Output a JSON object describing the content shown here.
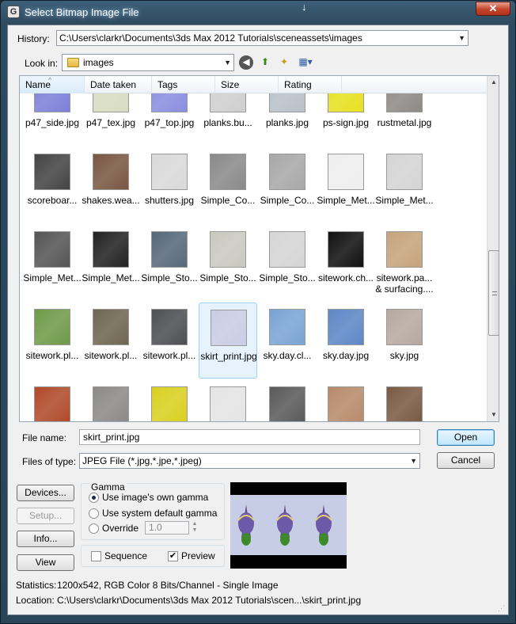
{
  "window": {
    "title": "Select Bitmap Image File",
    "close_glyph": "✕",
    "app_icon": "G"
  },
  "history": {
    "label": "History:",
    "value": "C:\\Users\\clarkr\\Documents\\3ds Max 2012 Tutorials\\sceneassets\\images"
  },
  "look_in": {
    "label": "Look in:",
    "value": "images"
  },
  "toolbar_icons": [
    "back-icon",
    "up-folder-icon",
    "new-folder-icon",
    "view-menu-icon"
  ],
  "columns": [
    "Name",
    "Date taken",
    "Tags",
    "Size",
    "Rating"
  ],
  "files": [
    {
      "name": "p47_side.jpg",
      "tint": "#7d80d8"
    },
    {
      "name": "p47_tex.jpg",
      "tint": "#d8dcc0"
    },
    {
      "name": "p47_top.jpg",
      "tint": "#8a8ee0"
    },
    {
      "name": "planks.bu...",
      "tint": "#cfcfcf"
    },
    {
      "name": "planks.jpg",
      "tint": "#b9c0c8"
    },
    {
      "name": "ps-sign.jpg",
      "tint": "#e8e020"
    },
    {
      "name": "rustmetal.jpg",
      "tint": "#8d8a86"
    },
    {
      "name": "scoreboar...",
      "tint": "#444444"
    },
    {
      "name": "shakes.wea...",
      "tint": "#7a5642"
    },
    {
      "name": "shutters.jpg",
      "tint": "#d9d9d9"
    },
    {
      "name": "Simple_Co...",
      "tint": "#8a8a8a"
    },
    {
      "name": "Simple_Co...",
      "tint": "#a8a8a8"
    },
    {
      "name": "Simple_Met...",
      "tint": "#eeeeee"
    },
    {
      "name": "Simple_Met...",
      "tint": "#d4d4d4"
    },
    {
      "name": "Simple_Met...",
      "tint": "#555555"
    },
    {
      "name": "Simple_Met...",
      "tint": "#222222"
    },
    {
      "name": "Simple_Sto...",
      "tint": "#56687a"
    },
    {
      "name": "Simple_Sto...",
      "tint": "#c9c9c0"
    },
    {
      "name": "Simple_Sto...",
      "tint": "#d5d5d5"
    },
    {
      "name": "sitework.ch...",
      "tint": "#111111"
    },
    {
      "name": "sitework.pa... & surfacing....",
      "tint": "#c6a47c"
    },
    {
      "name": "sitework.pl...",
      "tint": "#6f9a48"
    },
    {
      "name": "sitework.pl...",
      "tint": "#6e6650"
    },
    {
      "name": "sitework.pl...",
      "tint": "#4d4f52"
    },
    {
      "name": "skirt_print.jpg",
      "tint": "#c9cde4"
    },
    {
      "name": "sky.day.cl...",
      "tint": "#7aa4d4"
    },
    {
      "name": "sky.day.jpg",
      "tint": "#5d87c6"
    },
    {
      "name": "sky.jpg",
      "tint": "#b7a9a0"
    },
    {
      "name": "",
      "tint": "#b04a2a"
    },
    {
      "name": "",
      "tint": "#8c8a88"
    },
    {
      "name": "",
      "tint": "#d9d020"
    },
    {
      "name": "",
      "tint": "#e4e4e4"
    },
    {
      "name": "",
      "tint": "#5a5a5a"
    },
    {
      "name": "",
      "tint": "#b88a6a"
    },
    {
      "name": "",
      "tint": "#7a5a44"
    }
  ],
  "selected_file": "skirt_print.jpg",
  "file_name": {
    "label": "File name:",
    "value": "skirt_print.jpg"
  },
  "files_of_type": {
    "label": "Files of type:",
    "value": "JPEG File (*.jpg,*.jpe,*.jpeg)"
  },
  "buttons": {
    "open": "Open",
    "cancel": "Cancel",
    "devices": "Devices...",
    "setup": "Setup...",
    "info": "Info...",
    "view": "View"
  },
  "gamma": {
    "title": "Gamma",
    "own": "Use image's own gamma",
    "system": "Use system default gamma",
    "override": "Override",
    "override_value": "1.0",
    "selected": "own"
  },
  "options": {
    "sequence": "Sequence",
    "preview": "Preview",
    "sequence_checked": false,
    "preview_checked": true
  },
  "statistics": {
    "label": "Statistics:",
    "value": "1200x542, RGB Color 8 Bits/Channel - Single Image"
  },
  "location": {
    "label": "Location:",
    "value": "C:\\Users\\clarkr\\Documents\\3ds Max 2012 Tutorials\\scen...\\skirt_print.jpg"
  }
}
